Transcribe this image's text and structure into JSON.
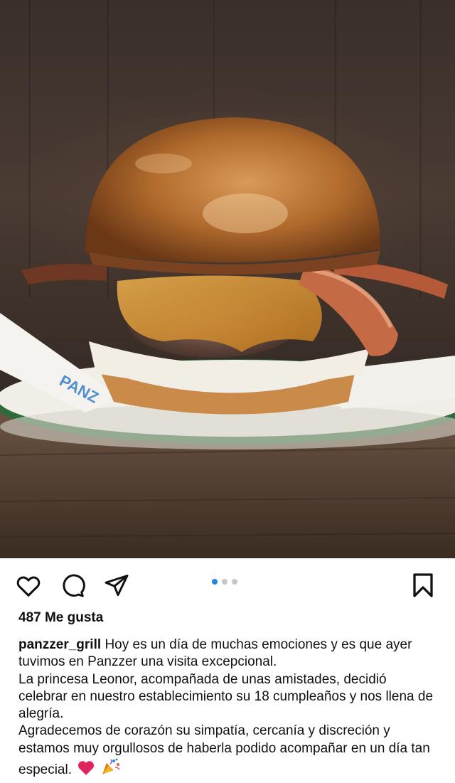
{
  "post": {
    "image_alt": "hamburguesa con queso y bacon",
    "likes_text": "487 Me gusta",
    "carousel": {
      "count": 3,
      "active_index": 0
    },
    "caption": {
      "username": "panzzer_grill",
      "line1": "Hoy es un día de muchas emociones y es que ayer tuvimos en Panzzer una visita excepcional.",
      "line2": "La princesa Leonor, acompañada de unas amistades, decidió celebrar en nuestro establecimiento su 18 cumpleaños y nos llena de alegría.",
      "line3": "Agradecemos de corazón su simpatía, cercanía y discreción y estamos muy orgullosos de haberla podido acompañar en un día tan especial.",
      "emojis": [
        "red-heart",
        "party-popper"
      ]
    }
  },
  "icons": {
    "like": "heart-outline-icon",
    "comment": "comment-bubble-icon",
    "share": "paper-plane-icon",
    "save": "bookmark-icon"
  },
  "colors": {
    "accent_dot": "#1e88e5",
    "heart": "#e0245e"
  }
}
